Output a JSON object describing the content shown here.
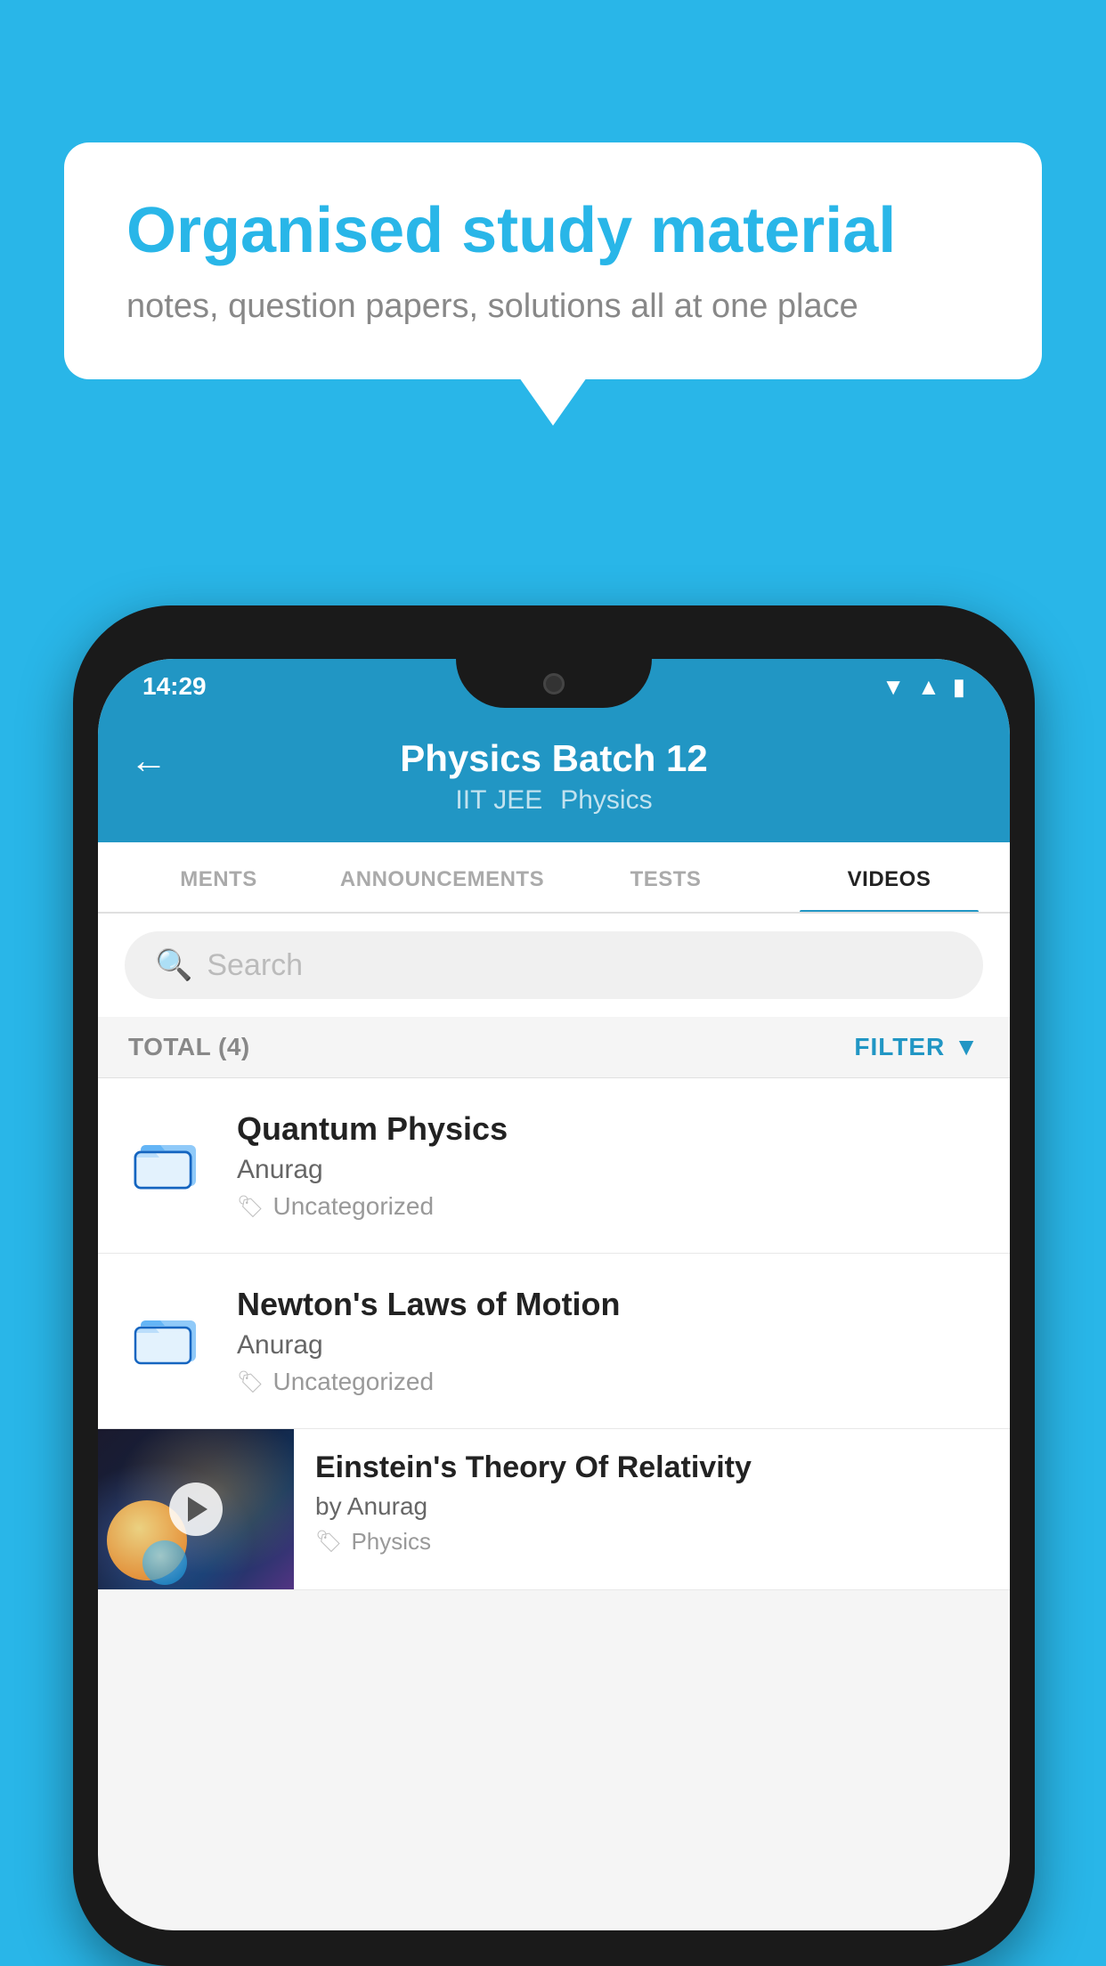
{
  "background_color": "#29b6e8",
  "bubble": {
    "title": "Organised study material",
    "subtitle": "notes, question papers, solutions all at one place"
  },
  "phone": {
    "status_bar": {
      "time": "14:29",
      "wifi": "▾",
      "signal": "▲",
      "battery": "▮"
    },
    "header": {
      "back_label": "←",
      "title": "Physics Batch 12",
      "subtitle_left": "IIT JEE",
      "subtitle_right": "Physics"
    },
    "tabs": [
      {
        "label": "MENTS",
        "active": false
      },
      {
        "label": "ANNOUNCEMENTS",
        "active": false
      },
      {
        "label": "TESTS",
        "active": false
      },
      {
        "label": "VIDEOS",
        "active": true
      }
    ],
    "search": {
      "placeholder": "Search"
    },
    "filter": {
      "total_label": "TOTAL (4)",
      "filter_label": "FILTER"
    },
    "list_items": [
      {
        "id": 1,
        "title": "Quantum Physics",
        "author": "Anurag",
        "tag": "Uncategorized",
        "type": "folder"
      },
      {
        "id": 2,
        "title": "Newton's Laws of Motion",
        "author": "Anurag",
        "tag": "Uncategorized",
        "type": "folder"
      },
      {
        "id": 3,
        "title": "Einstein's Theory Of Relativity",
        "author": "by Anurag",
        "tag": "Physics",
        "type": "video"
      }
    ]
  }
}
